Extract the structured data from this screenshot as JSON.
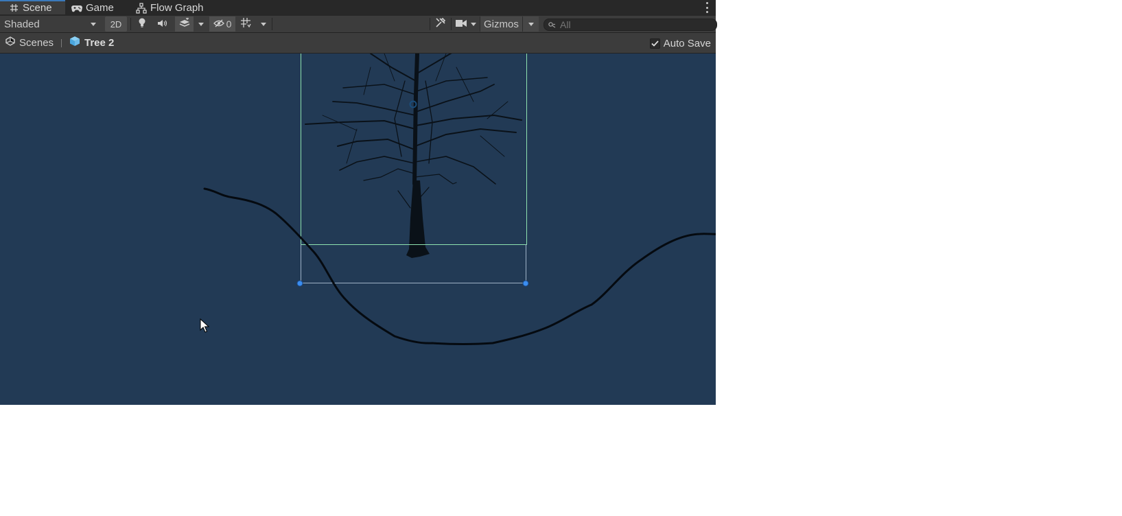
{
  "tabs": [
    {
      "label": "Scene",
      "icon": "grid-hash-icon",
      "active": true
    },
    {
      "label": "Game",
      "icon": "gamepad-icon",
      "active": false
    },
    {
      "label": "Flow Graph",
      "icon": "flow-graph-icon",
      "active": false
    }
  ],
  "toolbar": {
    "draw_mode": "Shaded",
    "mode_2d": "2D",
    "hidden_count": "0",
    "gizmos_label": "Gizmos",
    "search_placeholder": "All"
  },
  "breadcrumb": {
    "root": "Scenes",
    "current": "Tree 2"
  },
  "auto_save": {
    "label": "Auto Save",
    "checked": true
  },
  "colors": {
    "viewport_bg": "#223a55",
    "selection_green": "#8fe3b0",
    "rect_handle_blue": "#3b8df0",
    "active_tab_accent": "#3a79bb"
  }
}
